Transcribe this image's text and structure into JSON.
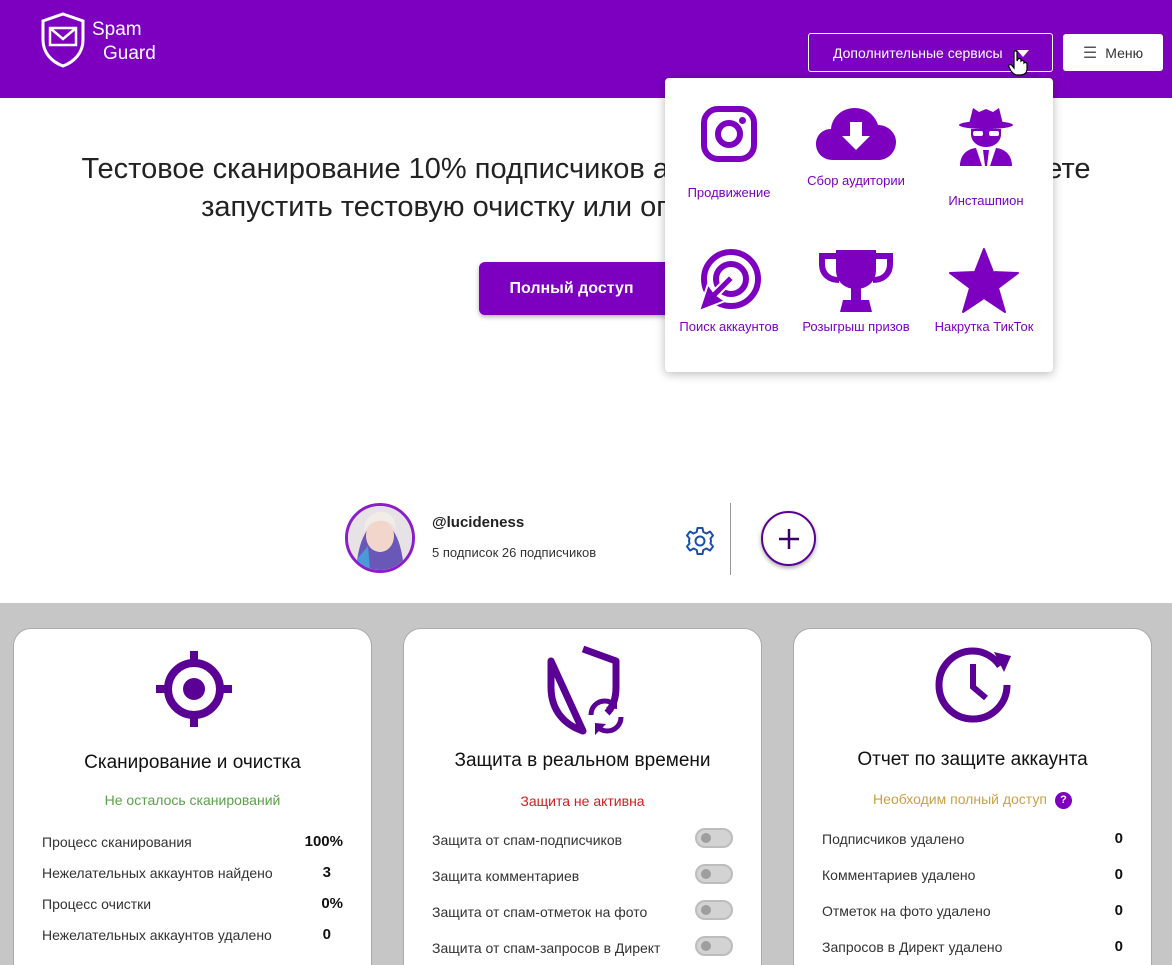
{
  "header": {
    "logo_line1": "Spam",
    "logo_line2": "Guard",
    "services_button": "Дополнительные сервисы",
    "menu_button": "Меню"
  },
  "hero": {
    "line1": "Тестовое сканирование 10% подписчиков аккаунта завершено. Вы можете",
    "line2": "запустить тестовую очистку или оплатить полный доступ",
    "cta_label": "Полный доступ"
  },
  "dropdown": {
    "items": [
      {
        "label": "Продвижение",
        "icon": "instagram-icon"
      },
      {
        "label": "Сбор аудитории",
        "icon": "cloud-download-icon"
      },
      {
        "label": "Инсташпион",
        "icon": "spy-icon"
      },
      {
        "label": "Поиск аккаунтов",
        "icon": "target-arrow-icon"
      },
      {
        "label": "Розыгрыш призов",
        "icon": "trophy-icon"
      },
      {
        "label": "Накрутка ТикТок",
        "icon": "star-icon"
      }
    ]
  },
  "account": {
    "username": "@lucideness",
    "stats": "5 подписок 26 подписчиков"
  },
  "cards": {
    "scan": {
      "title": "Сканирование и очистка",
      "status": "Не осталось сканирований",
      "status_color": "#5aa14a",
      "rows": [
        {
          "label": "Процесс сканирования",
          "value": "100%"
        },
        {
          "label": "Нежелательных аккаунтов найдено",
          "value": "3"
        },
        {
          "label": "Процесс очистки",
          "value": "0%"
        },
        {
          "label": "Нежелательных аккаунтов удалено",
          "value": "0"
        }
      ]
    },
    "realtime": {
      "title": "Защита в реальном времени",
      "status": "Защита не активна",
      "status_color": "#d21e1e",
      "rows": [
        {
          "label": "Защита от спам-подписчиков"
        },
        {
          "label": "Защита комментариев"
        },
        {
          "label": "Защита от спам-отметок на фото"
        },
        {
          "label": "Защита от спам-запросов в Директ"
        }
      ]
    },
    "report": {
      "title": "Отчет по защите аккаунта",
      "status": "Необходим полный доступ",
      "status_color": "#c9a04a",
      "help": "?",
      "rows": [
        {
          "label": "Подписчиков удалено",
          "value": "0"
        },
        {
          "label": "Комментариев удалено",
          "value": "0"
        },
        {
          "label": "Отметок на фото удалено",
          "value": "0"
        },
        {
          "label": "Запросов в Директ удалено",
          "value": "0"
        }
      ]
    }
  },
  "colors": {
    "brand": "#7d00c0",
    "icon_dark": "#5a0095"
  }
}
